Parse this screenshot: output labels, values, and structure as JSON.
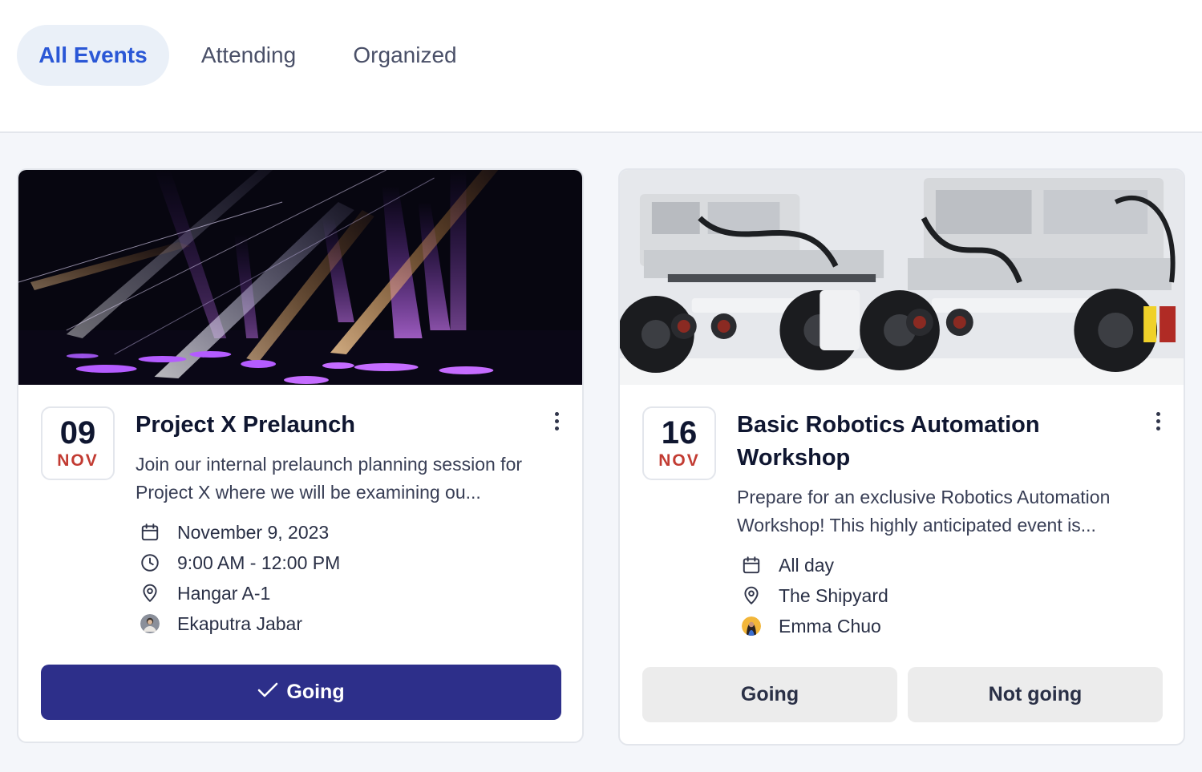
{
  "tabs": [
    {
      "label": "All Events",
      "active": true
    },
    {
      "label": "Attending",
      "active": false
    },
    {
      "label": "Organized",
      "active": false
    }
  ],
  "colors": {
    "accent": "#2a57d6",
    "primary_button": "#2d2f8a",
    "month": "#c23b32"
  },
  "events": [
    {
      "day": "09",
      "month": "NOV",
      "title": "Project X Prelaunch",
      "description": "Join our internal prelaunch planning session for Project X where we will be examining ou...",
      "date": "November 9, 2023",
      "time": "9:00 AM - 12:00 PM",
      "location": "Hangar A-1",
      "organizer": "Ekaputra Jabar",
      "going_label": "Going",
      "status": "going"
    },
    {
      "day": "16",
      "month": "NOV",
      "title": "Basic Robotics Automation Workshop",
      "description": "Prepare for an exclusive Robotics Automation Workshop! This highly anticipated event is...",
      "date": "All day",
      "location": "The Shipyard",
      "organizer": "Emma Chuo",
      "going_label": "Going",
      "not_going_label": "Not going",
      "status": "undecided"
    }
  ]
}
